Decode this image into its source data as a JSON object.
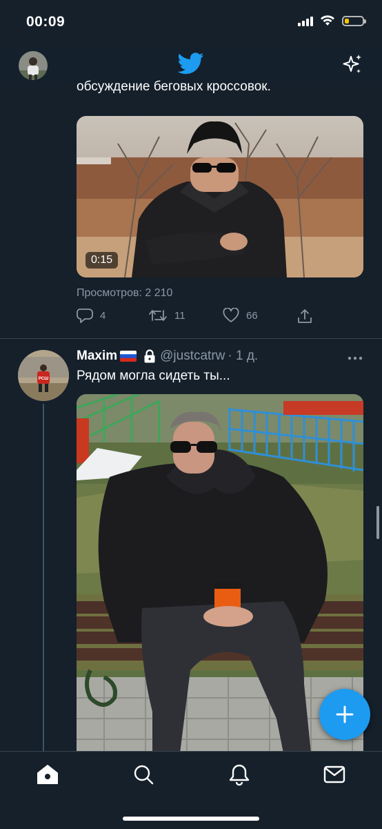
{
  "status_bar": {
    "time": "00:09",
    "battery_level": 0.25
  },
  "header": {
    "avatar_icon": "profile-avatar",
    "logo_icon": "twitter-bird-icon",
    "sparkle_icon": "sparkle-icon"
  },
  "tweet1": {
    "text_visible": "обсуждение беговых кроссовок.",
    "video_duration": "0:15",
    "views": "Просмотров: 2 210",
    "actions": {
      "replies": "4",
      "retweets": "11",
      "likes": "66"
    }
  },
  "tweet2": {
    "name": "Maxim",
    "flag": "RU",
    "handle": "@justcatrw",
    "time": "· 1 д.",
    "text": "Рядом могла сидеть ты...",
    "avatar_shirt_text": "РСШ"
  },
  "tabbar": {
    "items": [
      "home-icon",
      "search-icon",
      "bell-icon",
      "mail-icon"
    ]
  },
  "colors": {
    "background": "#15202b",
    "accent": "#1d9bf0",
    "muted": "#8b98a5",
    "divider": "#38444d"
  }
}
